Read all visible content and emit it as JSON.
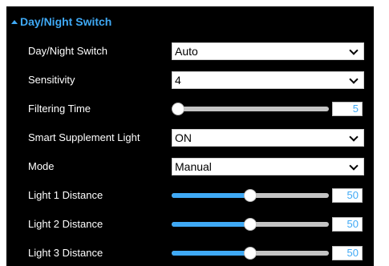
{
  "section": {
    "title": "Day/Night Switch",
    "collapse_icon": "caret-up-icon"
  },
  "accent_color": "#3fa9f5",
  "rows": [
    {
      "label": "Day/Night Switch",
      "type": "select",
      "value": "Auto"
    },
    {
      "label": "Sensitivity",
      "type": "select",
      "value": "4"
    },
    {
      "label": "Filtering Time",
      "type": "slider",
      "value": "5",
      "fraction": 0.0
    },
    {
      "label": "Smart Supplement Light",
      "type": "select",
      "value": "ON"
    },
    {
      "label": "Mode",
      "type": "select",
      "value": "Manual"
    },
    {
      "label": "Light 1 Distance",
      "type": "slider",
      "value": "50",
      "fraction": 0.5
    },
    {
      "label": "Light 2 Distance",
      "type": "slider",
      "value": "50",
      "fraction": 0.5
    },
    {
      "label": "Light 3 Distance",
      "type": "slider",
      "value": "50",
      "fraction": 0.5
    }
  ]
}
